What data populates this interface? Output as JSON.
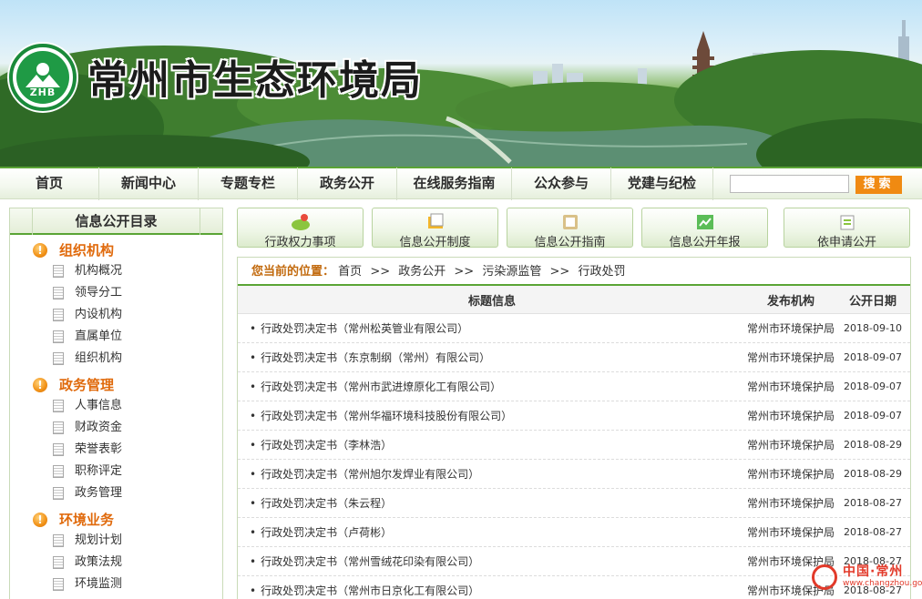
{
  "header": {
    "site_title": "常州市生态环境局",
    "logo_text": "ZHB"
  },
  "nav": {
    "items": [
      "首页",
      "新闻中心",
      "专题专栏",
      "政务公开",
      "在线服务指南",
      "公众参与",
      "党建与纪检"
    ],
    "search_placeholder": "",
    "search_button": "搜索"
  },
  "sidebar": {
    "title": "信息公开目录",
    "sections": [
      {
        "title": "组织机构",
        "items": [
          "机构概况",
          "领导分工",
          "内设机构",
          "直属单位",
          "组织机构"
        ]
      },
      {
        "title": "政务管理",
        "items": [
          "人事信息",
          "财政资金",
          "荣誉表彰",
          "职称评定",
          "政务管理"
        ]
      },
      {
        "title": "环境业务",
        "items": [
          "规划计划",
          "政策法规",
          "环境监测"
        ]
      }
    ]
  },
  "quick_links": [
    {
      "label": "行政权力事项",
      "icon": "power-matters-icon"
    },
    {
      "label": "信息公开制度",
      "icon": "disclosure-rules-icon"
    },
    {
      "label": "信息公开指南",
      "icon": "disclosure-guide-icon"
    },
    {
      "label": "信息公开年报",
      "icon": "annual-report-icon"
    },
    {
      "label": "依申请公开",
      "icon": "apply-disclosure-icon"
    }
  ],
  "breadcrumb": {
    "label": "您当前的位置：",
    "path": [
      "首页",
      "政务公开",
      "污染源监管",
      "行政处罚"
    ],
    "separator": ">>"
  },
  "table": {
    "headers": {
      "title": "标题信息",
      "org": "发布机构",
      "date": "公开日期"
    },
    "rows": [
      {
        "title": "行政处罚决定书（常州松英管业有限公司）",
        "org": "常州市环境保护局",
        "date": "2018-09-10"
      },
      {
        "title": "行政处罚决定书（东京制纲（常州）有限公司）",
        "org": "常州市环境保护局",
        "date": "2018-09-07"
      },
      {
        "title": "行政处罚决定书（常州市武进燎原化工有限公司）",
        "org": "常州市环境保护局",
        "date": "2018-09-07"
      },
      {
        "title": "行政处罚决定书（常州华福环境科技股份有限公司）",
        "org": "常州市环境保护局",
        "date": "2018-09-07"
      },
      {
        "title": "行政处罚决定书（李林浩）",
        "org": "常州市环境保护局",
        "date": "2018-08-29"
      },
      {
        "title": "行政处罚决定书（常州旭尔发焊业有限公司）",
        "org": "常州市环境保护局",
        "date": "2018-08-29"
      },
      {
        "title": "行政处罚决定书（朱云程）",
        "org": "常州市环境保护局",
        "date": "2018-08-27"
      },
      {
        "title": "行政处罚决定书（卢荷彬）",
        "org": "常州市环境保护局",
        "date": "2018-08-27"
      },
      {
        "title": "行政处罚决定书（常州雪绒花印染有限公司）",
        "org": "常州市环境保护局",
        "date": "2018-08-27"
      },
      {
        "title": "行政处罚决定书（常州市日京化工有限公司）",
        "org": "常州市环境保护局",
        "date": "2018-08-27"
      }
    ]
  },
  "watermark": {
    "text": "中国·常州",
    "url": "www.changzhou.gov.cn"
  },
  "colors": {
    "brand_green": "#5aa435",
    "accent_orange": "#f08a12",
    "section_orange": "#e06a0c"
  }
}
